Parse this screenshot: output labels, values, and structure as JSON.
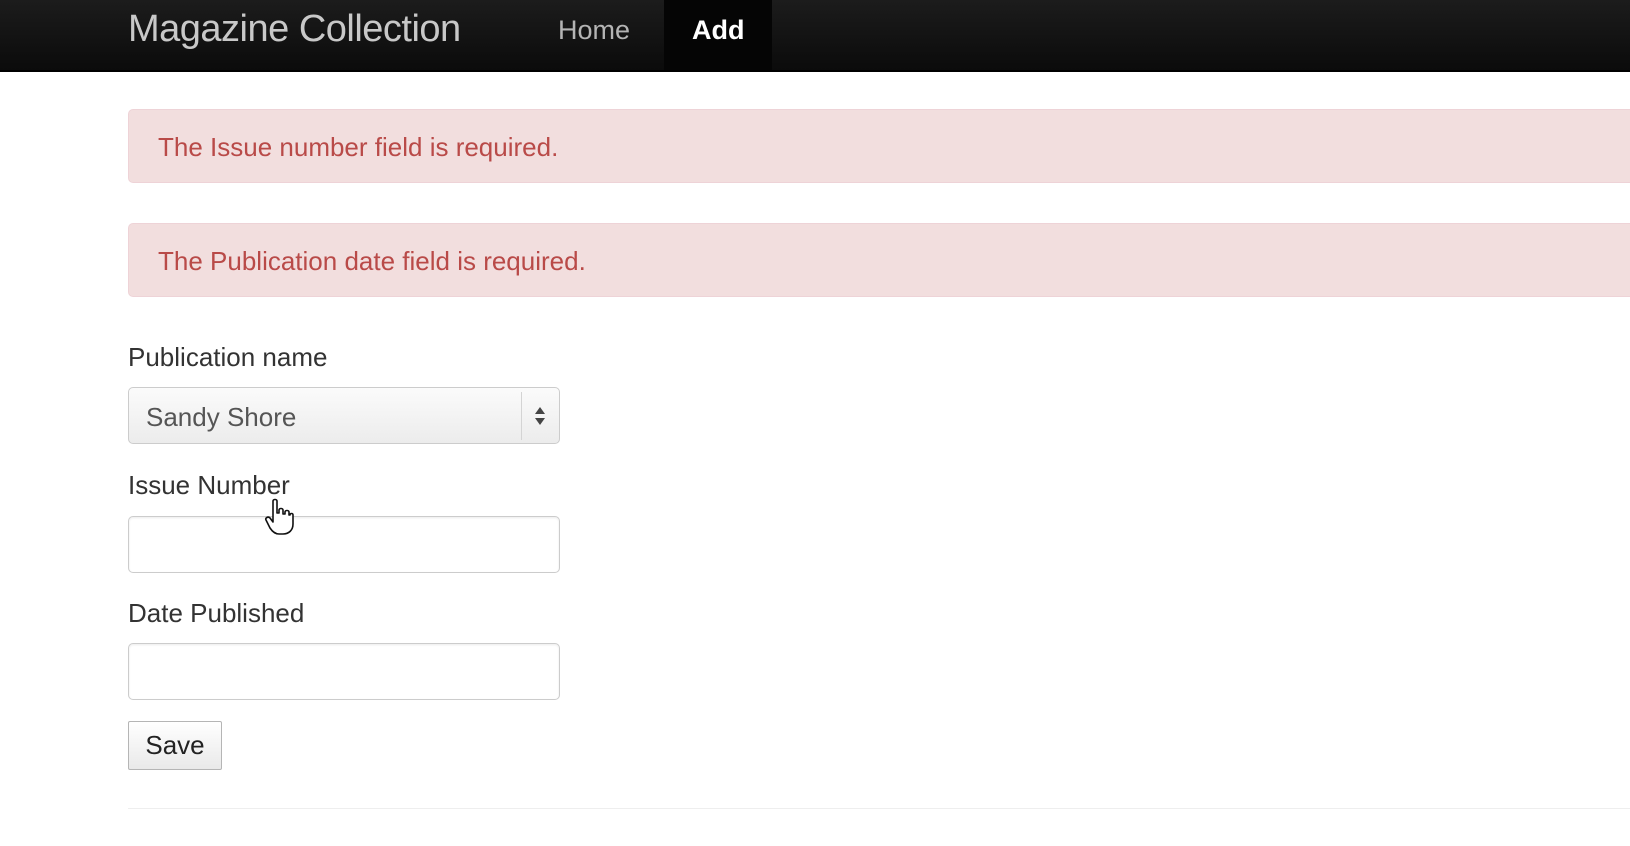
{
  "navbar": {
    "brand": "Magazine Collection",
    "items": [
      {
        "label": "Home",
        "active": false
      },
      {
        "label": "Add",
        "active": true
      }
    ]
  },
  "alerts": [
    "The Issue number field is required.",
    "The Publication date field is required."
  ],
  "form": {
    "publication_label": "Publication name",
    "publication_value": "Sandy Shore",
    "issue_label": "Issue Number",
    "issue_value": "",
    "date_label": "Date Published",
    "date_value": "",
    "save_label": "Save"
  },
  "colors": {
    "alert_bg": "#f2dede",
    "alert_text": "#b94a48",
    "navbar_bg": "#111111"
  },
  "icons": {
    "select_arrows": "select-arrows-icon",
    "cursor": "hand-pointer-cursor-icon"
  }
}
